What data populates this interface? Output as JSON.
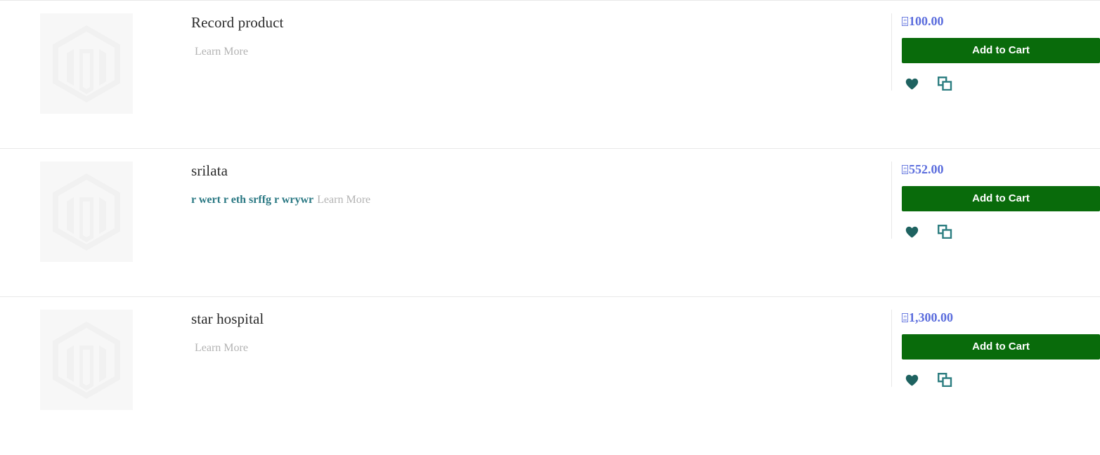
{
  "page": {
    "type": "product-list",
    "currency_symbol_codepoint": "20B9",
    "currency_symbol_note": "missing-glyph-box"
  },
  "theme": {
    "add_to_cart_bg": "#096b0b",
    "price_color": "#5b6ddd",
    "description_color": "#2a7883",
    "learn_more_color": "#b3b3b3",
    "divider_color": "#e8e8e8",
    "photo_bg": "#f7f7f7",
    "icon_color": "#1e6260",
    "compare_icon_color": "#2c7d80"
  },
  "labels": {
    "add_to_cart": "Add to Cart",
    "learn_more": "Learn More",
    "wishlist_icon": "heart-icon",
    "compare_icon": "compare-icon",
    "placeholder_image": "magento-placeholder-logo"
  },
  "products": [
    {
      "name": "Record product",
      "description": "",
      "learn_more": "Learn More",
      "price": "100.00",
      "add_to_cart": "Add to Cart"
    },
    {
      "name": "srilata",
      "description": "r wert r eth srffg r wrywr",
      "learn_more": "Learn More",
      "price": "552.00",
      "add_to_cart": "Add to Cart"
    },
    {
      "name": "star hospital",
      "description": "",
      "learn_more": "Learn More",
      "price": "1,300.00",
      "add_to_cart": "Add to Cart"
    }
  ]
}
